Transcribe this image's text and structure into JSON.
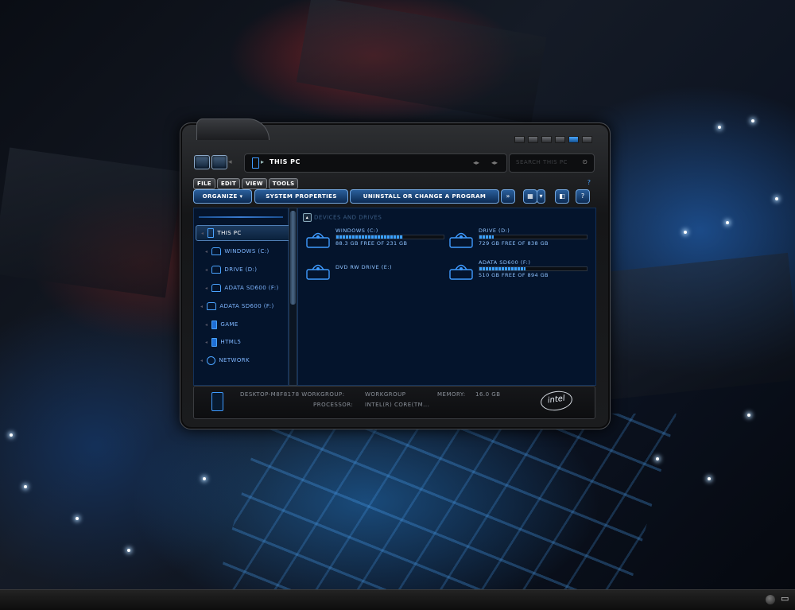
{
  "window": {
    "address_crumb": "THIS PC",
    "search_placeholder": "SEARCH THIS PC"
  },
  "menubar": [
    "FILE",
    "EDIT",
    "VIEW",
    "TOOLS"
  ],
  "toolbar": {
    "organize": "ORGANIZE ▾",
    "system_properties": "SYSTEM PROPERTIES",
    "uninstall": "UNINSTALL OR CHANGE A PROGRAM",
    "more": "»",
    "help": "?"
  },
  "sidebar": {
    "items": [
      {
        "label": "THIS PC",
        "icon": "pc-icon"
      },
      {
        "label": "WINDOWS (C:)",
        "icon": "drive-icon"
      },
      {
        "label": "DRIVE (D:)",
        "icon": "drive-icon"
      },
      {
        "label": "ADATA SD600 (F:)",
        "icon": "drive-icon"
      },
      {
        "label": "ADATA SD600 (F:)",
        "icon": "drive-icon"
      },
      {
        "label": "GAME",
        "icon": "folder-icon"
      },
      {
        "label": "HTML5",
        "icon": "folder-icon"
      },
      {
        "label": "NETWORK",
        "icon": "globe-icon"
      }
    ]
  },
  "content": {
    "group_header": "DEVICES AND DRIVES",
    "drives": [
      {
        "name": "WINDOWS (C:)",
        "free_text": "88.3 GB FREE OF 231 GB",
        "used_fraction": 0.62
      },
      {
        "name": "DRIVE (D:)",
        "free_text": "729 GB FREE OF 838 GB",
        "used_fraction": 0.13
      },
      {
        "name": "DVD RW DRIVE (E:)",
        "free_text": "",
        "used_fraction": null
      },
      {
        "name": "ADATA SD600 (F:)",
        "free_text": "510 GB FREE OF 894 GB",
        "used_fraction": 0.43
      }
    ]
  },
  "details": {
    "computer": "DESKTOP-M8F8178 WORKGROUP:",
    "workgroup": "WORKGROUP",
    "memory_label": "MEMORY:",
    "memory_value": "16.0 GB",
    "processor_label": "PROCESSOR:",
    "processor_value": "INTEL(R) CORE(TM...",
    "brand": "intel"
  },
  "colors": {
    "accent": "#3aa0ff",
    "panel": "#04142c",
    "frame": "#1b1c1e"
  }
}
